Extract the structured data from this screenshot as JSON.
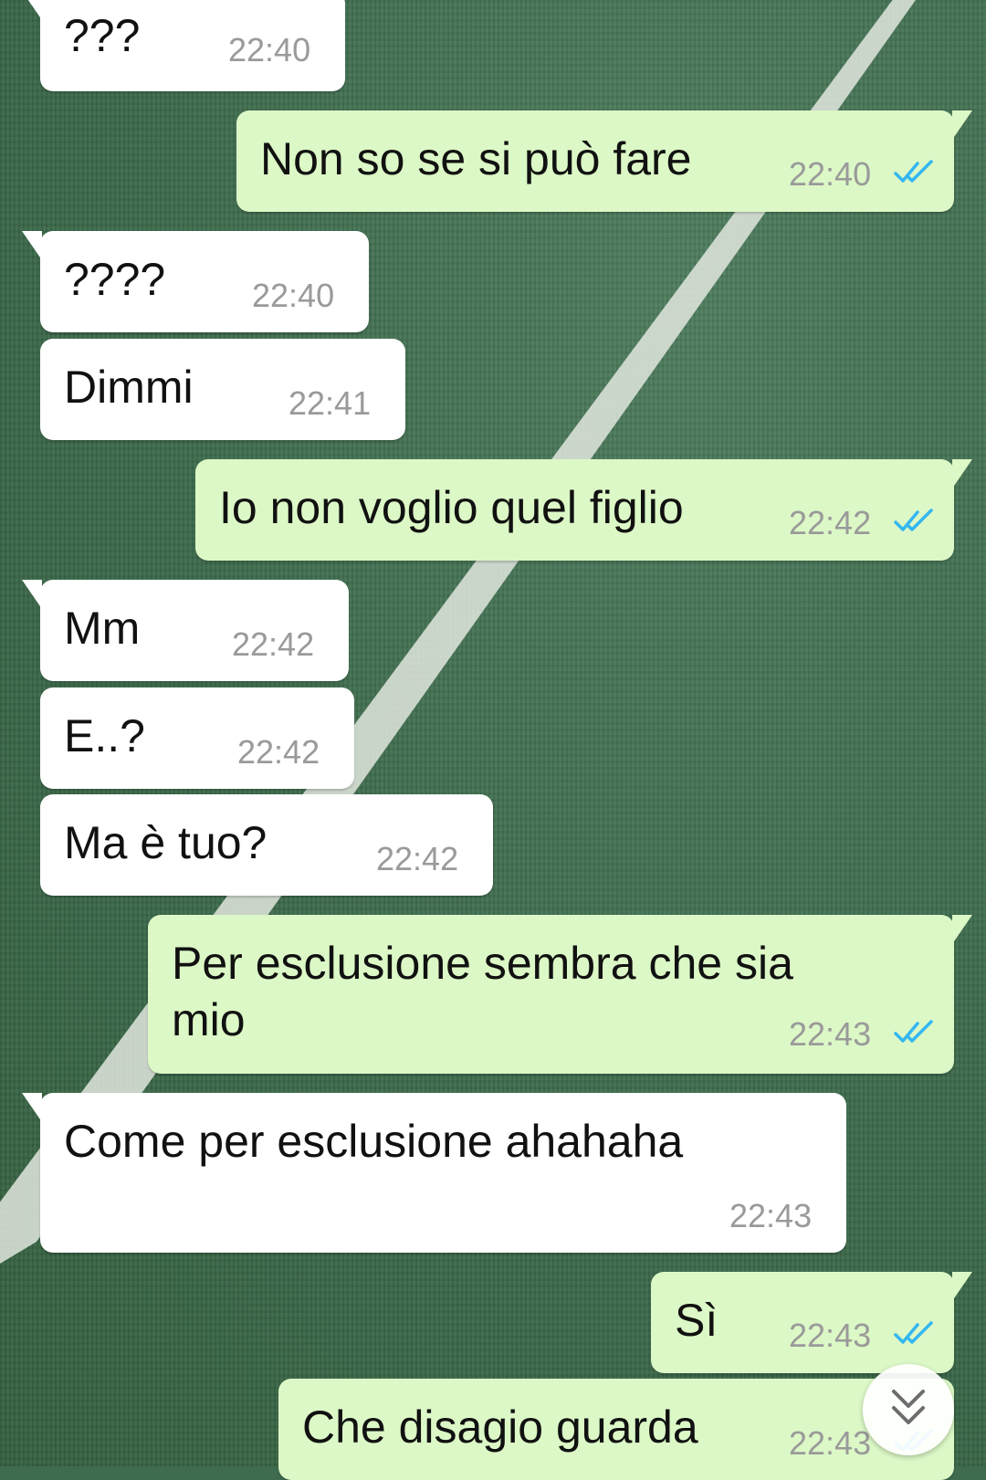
{
  "messages": [
    {
      "dir": "in",
      "text": "???",
      "time": "22:40"
    },
    {
      "dir": "out",
      "text": "Non so se si può fare",
      "time": "22:40"
    },
    {
      "dir": "in",
      "text": "????",
      "time": "22:40"
    },
    {
      "dir": "in",
      "text": "Dimmi",
      "time": "22:41"
    },
    {
      "dir": "out",
      "text": "Io non voglio quel figlio",
      "time": "22:42"
    },
    {
      "dir": "in",
      "text": "Mm",
      "time": "22:42"
    },
    {
      "dir": "in",
      "text": "E..?",
      "time": "22:42"
    },
    {
      "dir": "in",
      "text": "Ma è tuo?",
      "time": "22:42"
    },
    {
      "dir": "out",
      "text": "Per esclusione sembra che sia mio",
      "time": "22:43"
    },
    {
      "dir": "in",
      "text": "Come per esclusione ahahaha",
      "time": "22:43"
    },
    {
      "dir": "out",
      "text": "Sì",
      "time": "22:43"
    },
    {
      "dir": "out",
      "text": "Che disagio guarda",
      "time": "22:43"
    }
  ],
  "read_receipt": "double-check-icon",
  "scroll_button": "chevron-double-down-icon",
  "colors": {
    "incoming_bubble": "#ffffff",
    "outgoing_bubble": "#dcf8c6",
    "timestamp": "#9a9a9a",
    "read_ticks": "#34b7f1"
  }
}
